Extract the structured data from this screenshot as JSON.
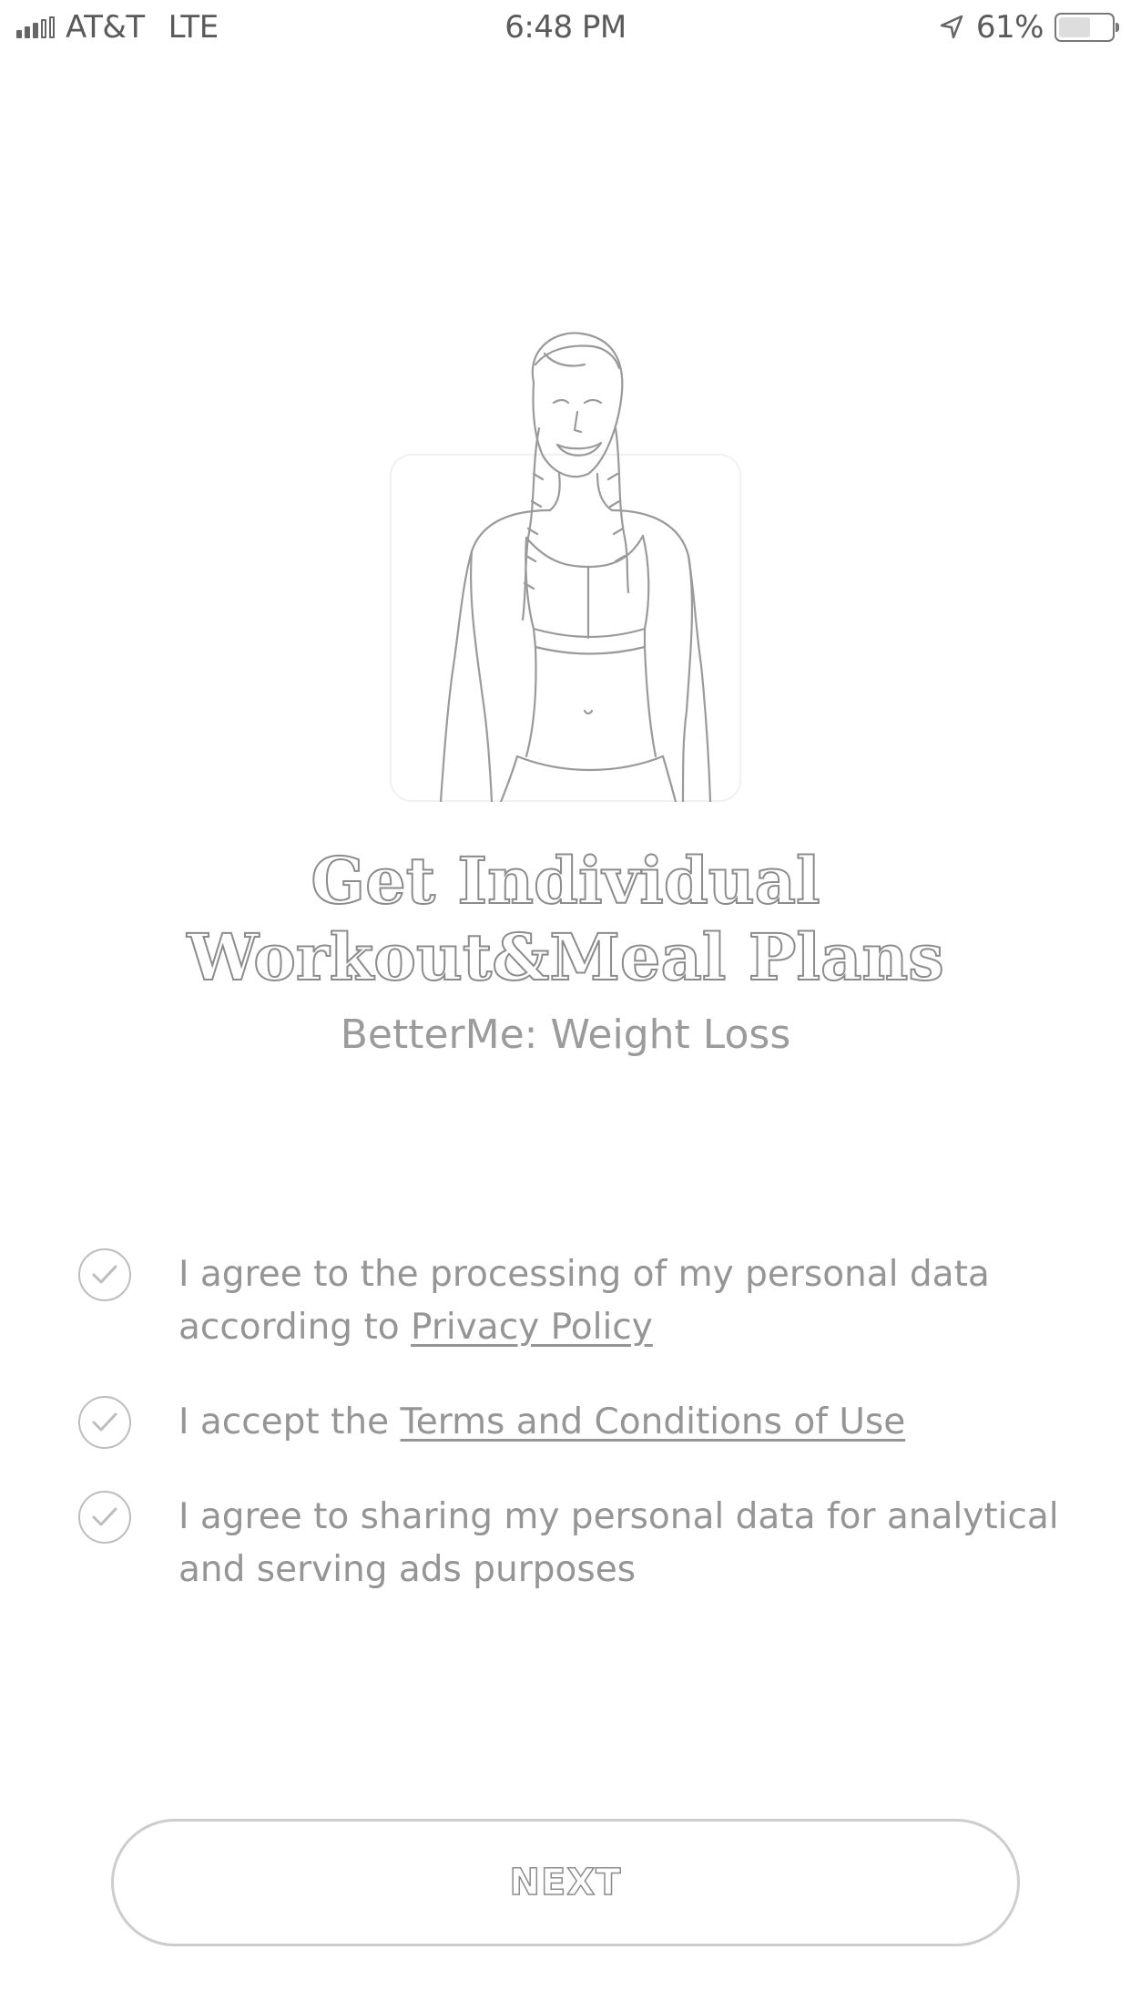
{
  "status_bar": {
    "carrier": "AT&T",
    "network": "LTE",
    "time": "6:48 PM",
    "battery_percent": "61%",
    "battery_level": 0.61,
    "location_icon": "location-arrow-icon",
    "signal_icon": "signal-bars-icon"
  },
  "hero": {
    "image": "woman-in-sports-bra-illustration"
  },
  "title_lines": [
    "Get Individual",
    "Workout&Meal Plans"
  ],
  "subtitle": "BetterMe: Weight Loss",
  "consents": [
    {
      "icon": "checkmark-circle-icon",
      "text_line1": "I agree to the processing of my personal data",
      "text_prefix": "according to ",
      "link": "Privacy Policy"
    },
    {
      "icon": "checkmark-circle-icon",
      "text_prefix": "I accept the ",
      "link": "Terms and Conditions of Use"
    },
    {
      "icon": "checkmark-circle-icon",
      "text_line1": "I agree to sharing my personal data for analytical",
      "text_line2": "and serving ads purposes"
    }
  ],
  "next_label": "NEXT",
  "colors": {
    "background": "#ffffff",
    "text": "#959595",
    "outline": "#cdcdcd"
  }
}
